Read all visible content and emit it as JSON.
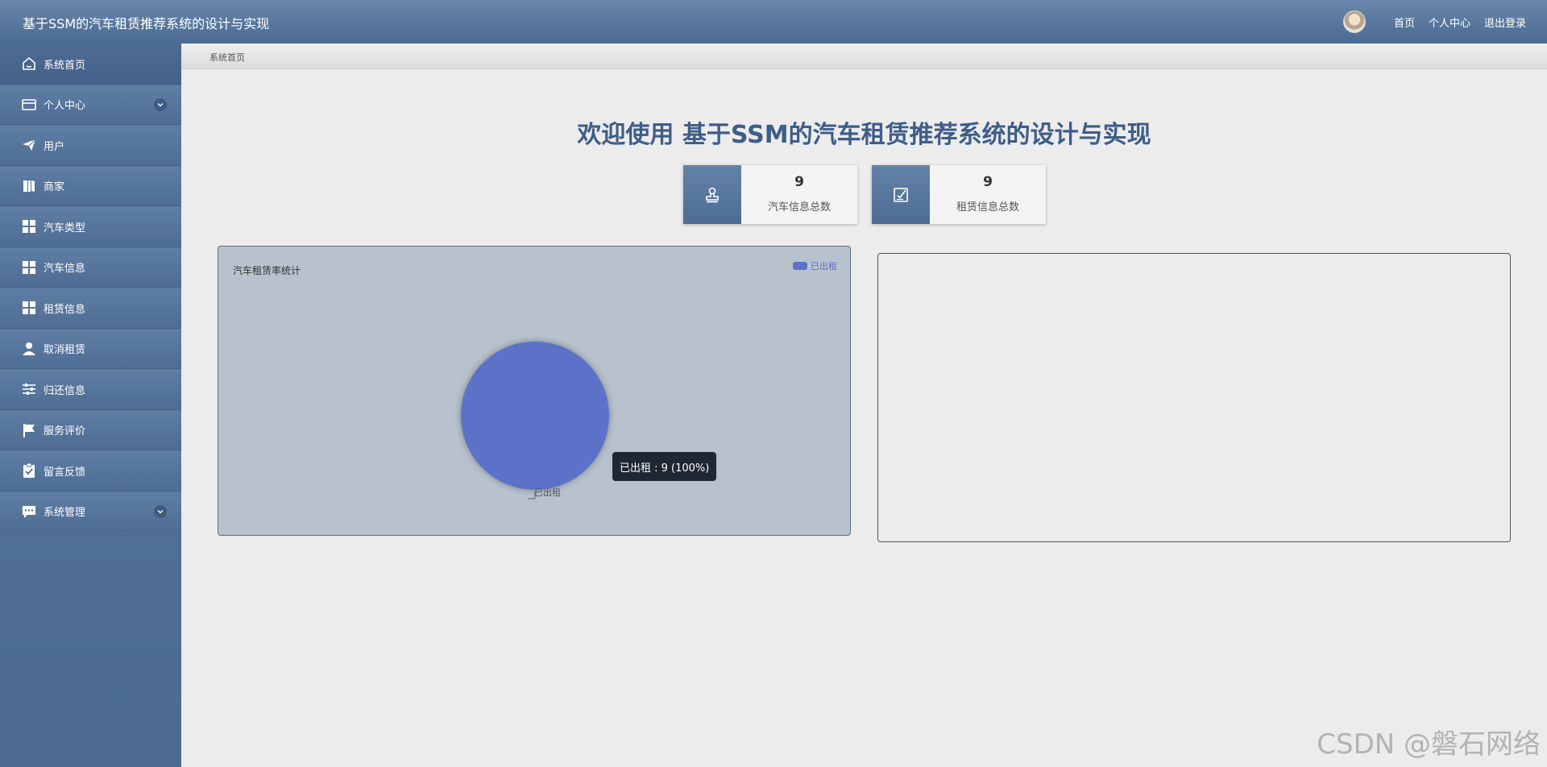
{
  "header": {
    "app_title": "基于SSM的汽车租赁推荐系统的设计与实现",
    "links": [
      "首页",
      "个人中心",
      "退出登录"
    ]
  },
  "sidebar": {
    "items": [
      {
        "label": "系统首页",
        "icon": "home-icon",
        "expandable": false
      },
      {
        "label": "个人中心",
        "icon": "card-icon",
        "expandable": true
      },
      {
        "label": "用户",
        "icon": "paper-plane-icon",
        "expandable": false
      },
      {
        "label": "商家",
        "icon": "book-icon",
        "expandable": false
      },
      {
        "label": "汽车类型",
        "icon": "grid-icon",
        "expandable": false
      },
      {
        "label": "汽车信息",
        "icon": "grid-icon",
        "expandable": false
      },
      {
        "label": "租赁信息",
        "icon": "grid-icon",
        "expandable": false
      },
      {
        "label": "取消租赁",
        "icon": "user-icon",
        "expandable": false
      },
      {
        "label": "归还信息",
        "icon": "sliders-icon",
        "expandable": false
      },
      {
        "label": "服务评价",
        "icon": "flag-icon",
        "expandable": false
      },
      {
        "label": "留言反馈",
        "icon": "clipboard-check-icon",
        "expandable": false
      },
      {
        "label": "系统管理",
        "icon": "chat-icon",
        "expandable": true
      }
    ]
  },
  "breadcrumb": "系统首页",
  "welcome": "欢迎使用 基于SSM的汽车租赁推荐系统的设计与实现",
  "stats": [
    {
      "value": "9",
      "label": "汽车信息总数",
      "icon": "stamp-icon"
    },
    {
      "value": "9",
      "label": "租赁信息总数",
      "icon": "edit-note-icon"
    }
  ],
  "chart_data": {
    "type": "pie",
    "title": "汽车租赁率统计",
    "slices": [
      {
        "name": "已出租",
        "value": 9,
        "percent": 100
      }
    ],
    "legend": [
      "已出租"
    ],
    "legend_position": "top-right",
    "tooltip": "已出租 : 9 (100%)",
    "colors": [
      "#5b72c8"
    ]
  },
  "watermark": "CSDN @磐石网络",
  "theme": {
    "primary": "#4e6d94",
    "title_color": "#3e5d88"
  }
}
